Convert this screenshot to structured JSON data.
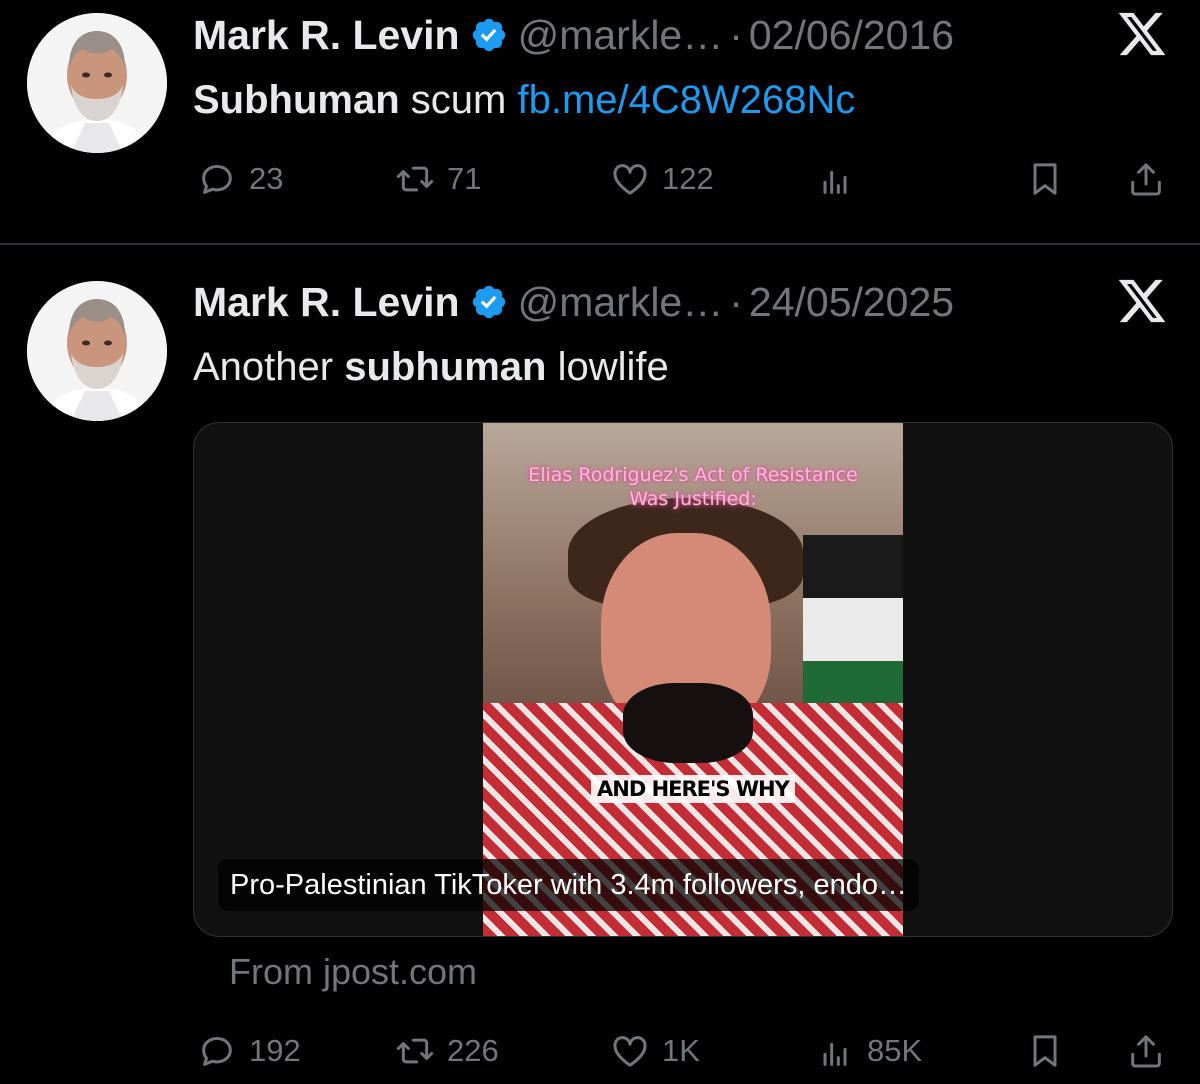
{
  "tweets": [
    {
      "author": {
        "name": "Mark R. Levin",
        "handle": "@markle…",
        "avatar": "avatar-photo",
        "verified_icon": "verified-badge-icon"
      },
      "separator": "·",
      "date": "02/06/2016",
      "text": {
        "bold": "Subhuman",
        "plain": " scum ",
        "link": "fb.me/4C8W268Nc"
      },
      "actions": {
        "replies": "23",
        "reposts": "71",
        "likes": "122",
        "views": ""
      }
    },
    {
      "author": {
        "name": "Mark R. Levin",
        "handle": "@markle…",
        "avatar": "avatar-photo",
        "verified_icon": "verified-badge-icon"
      },
      "separator": "·",
      "date": "24/05/2025",
      "text": {
        "pre": "Another ",
        "bold": "subhuman",
        "post": " lowlife"
      },
      "media": {
        "overlay_top_line1": "Elias Rodriguez's Act of Resistance",
        "overlay_top_line2": "Was Justified:",
        "overlay_mid": "AND HERE'S WHY",
        "caption": "Pro-Palestinian TikToker with 3.4m followers, endo…"
      },
      "source": "From jpost.com",
      "actions": {
        "replies": "192",
        "reposts": "226",
        "likes": "1K",
        "views": "85K"
      }
    }
  ],
  "icons": [
    "x-logo-icon",
    "reply-icon",
    "repost-icon",
    "like-icon",
    "views-icon",
    "bookmark-icon",
    "share-icon"
  ],
  "colors": {
    "background": "#000000",
    "text": "#e7e9ea",
    "muted": "#71767b",
    "link": "#1d9bf0",
    "verified": "#1d9bf0",
    "divider": "#2f3336"
  }
}
